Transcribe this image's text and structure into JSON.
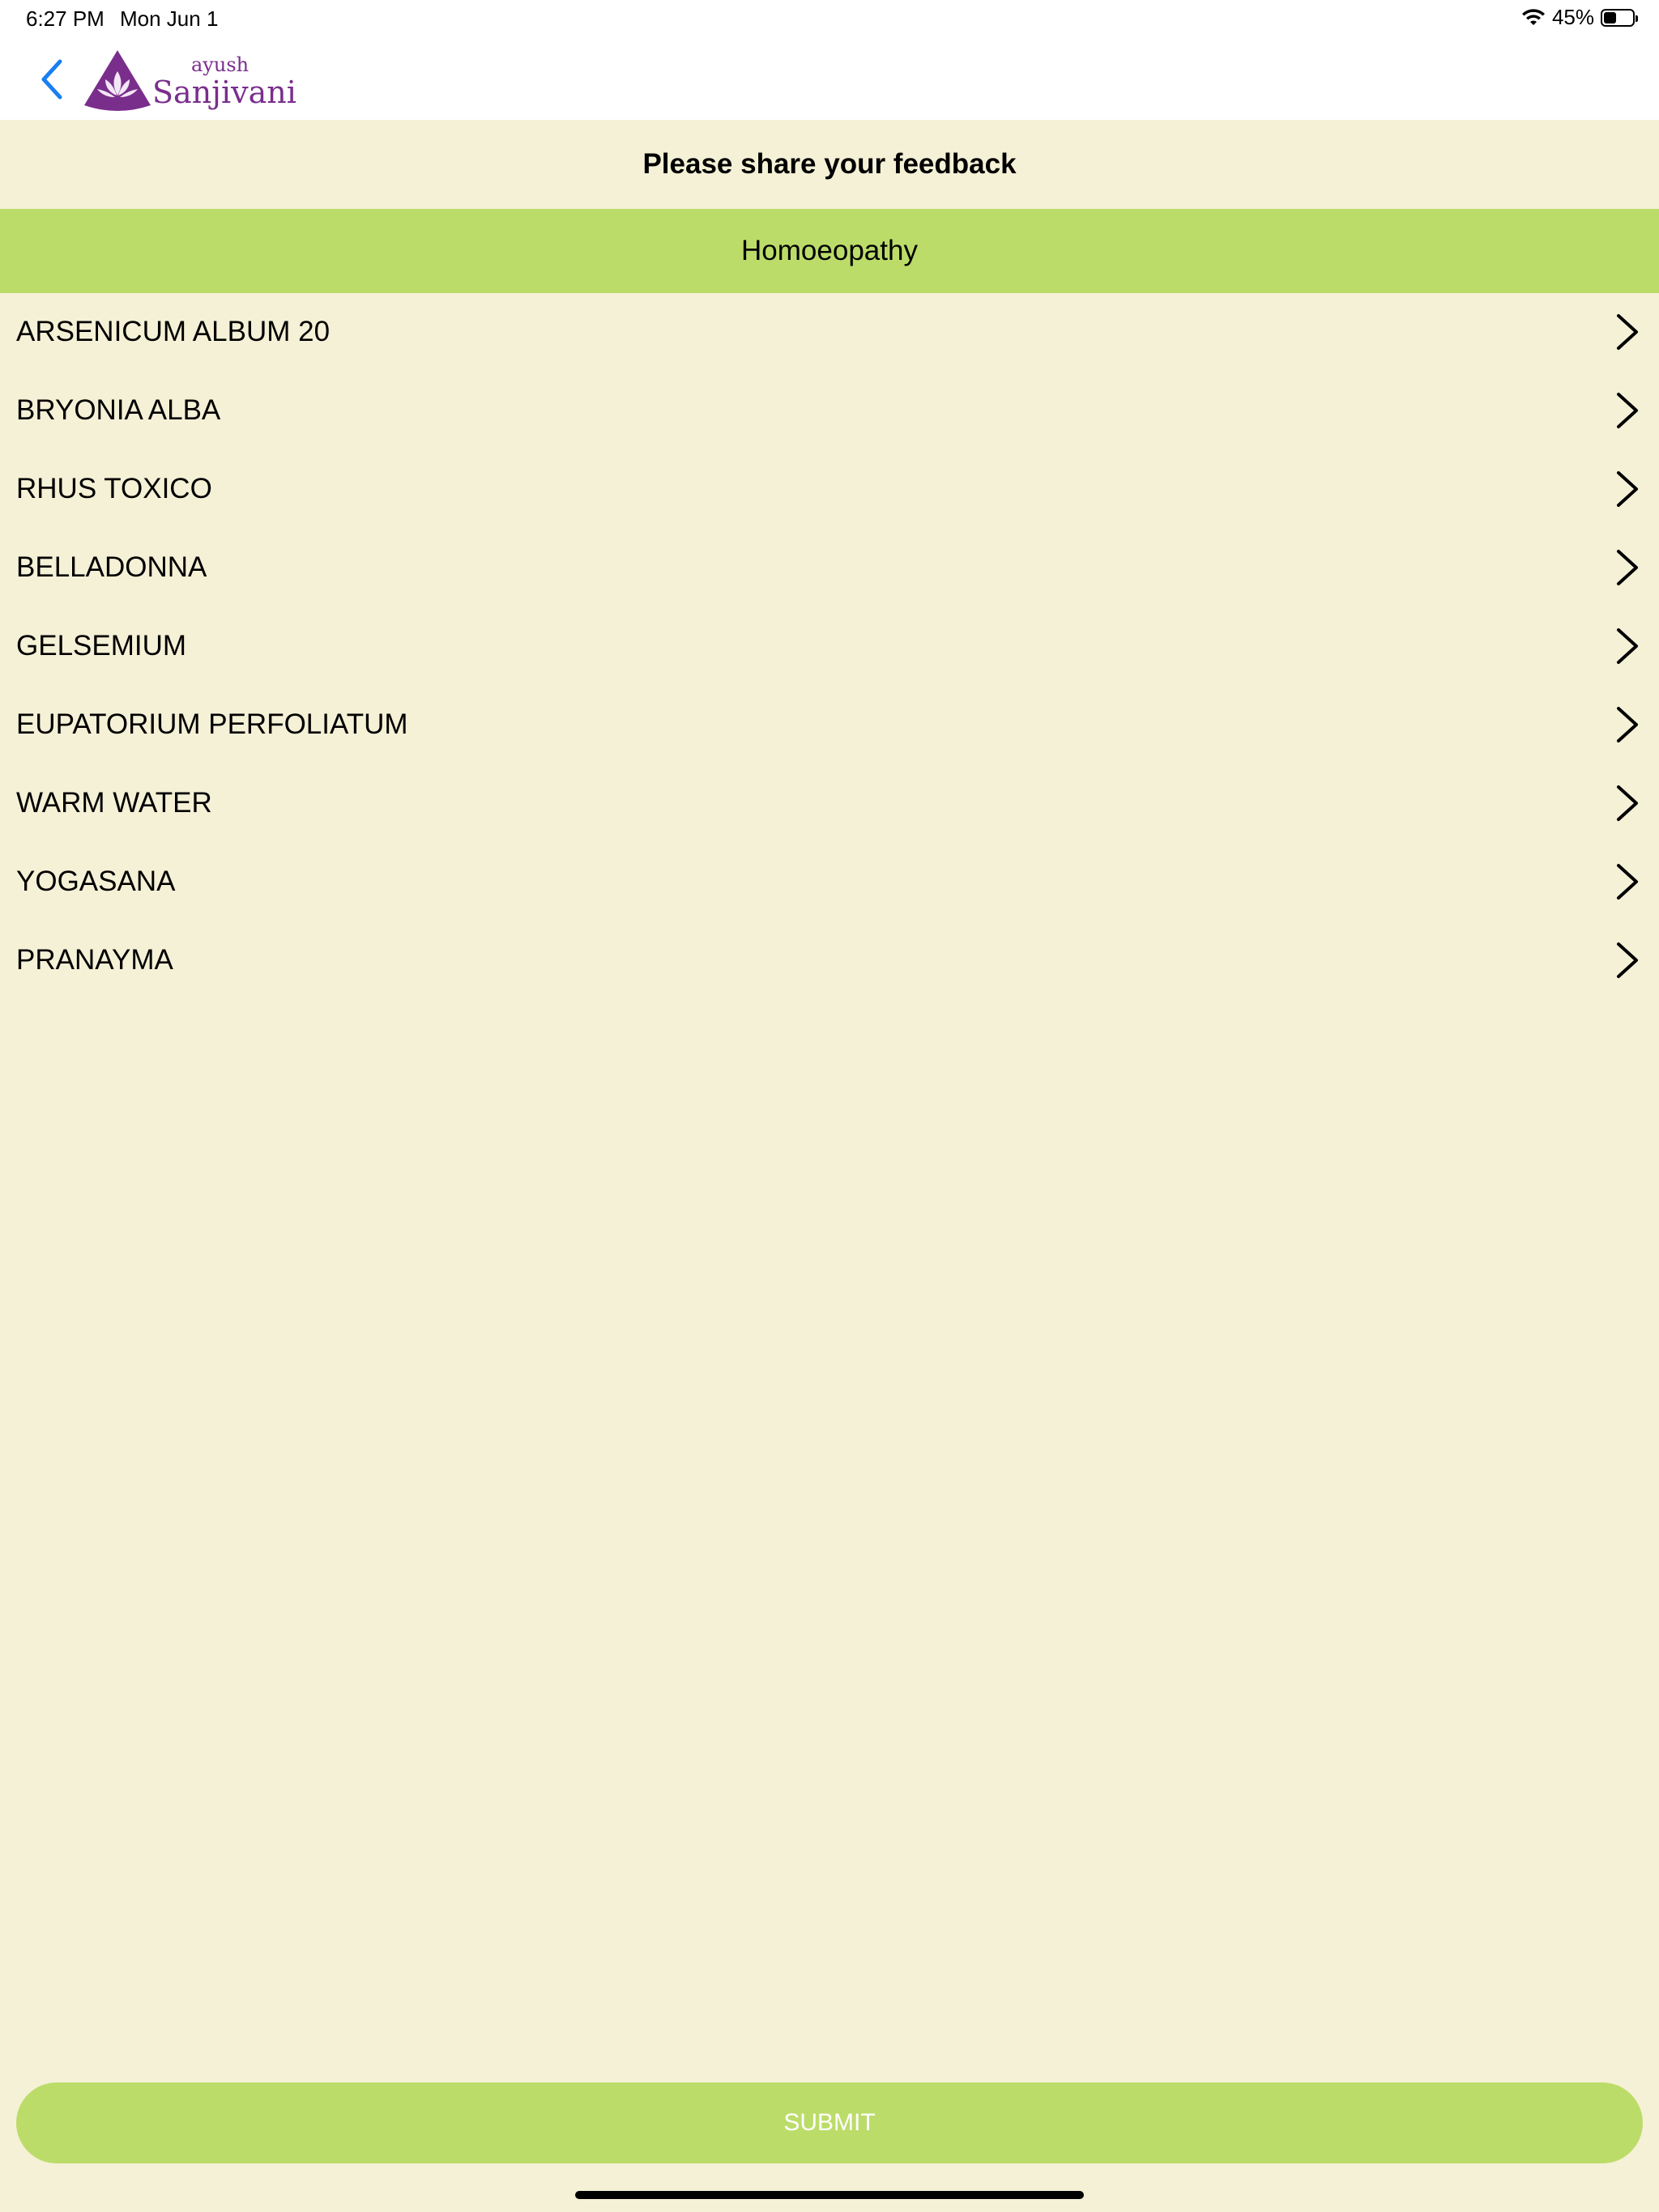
{
  "status_bar": {
    "time": "6:27 PM",
    "date": "Mon Jun 1",
    "battery_label": "45%",
    "battery_level": 0.45
  },
  "nav": {
    "logo_sub": "ayush",
    "logo_main": "Sanjivani",
    "brand_color": "#7a2e8c",
    "back_color": "#1a7ff0"
  },
  "feedback_title": "Please share your feedback",
  "category": "Homoeopathy",
  "accent_color": "#bcdc6a",
  "items": [
    {
      "label": "ARSENICUM ALBUM 20"
    },
    {
      "label": "BRYONIA ALBA"
    },
    {
      "label": "RHUS TOXICO"
    },
    {
      "label": "BELLADONNA"
    },
    {
      "label": "GELSEMIUM"
    },
    {
      "label": "EUPATORIUM PERFOLIATUM"
    },
    {
      "label": "WARM WATER"
    },
    {
      "label": "YOGASANA"
    },
    {
      "label": "PRANAYMA"
    }
  ],
  "submit_label": "SUBMIT"
}
